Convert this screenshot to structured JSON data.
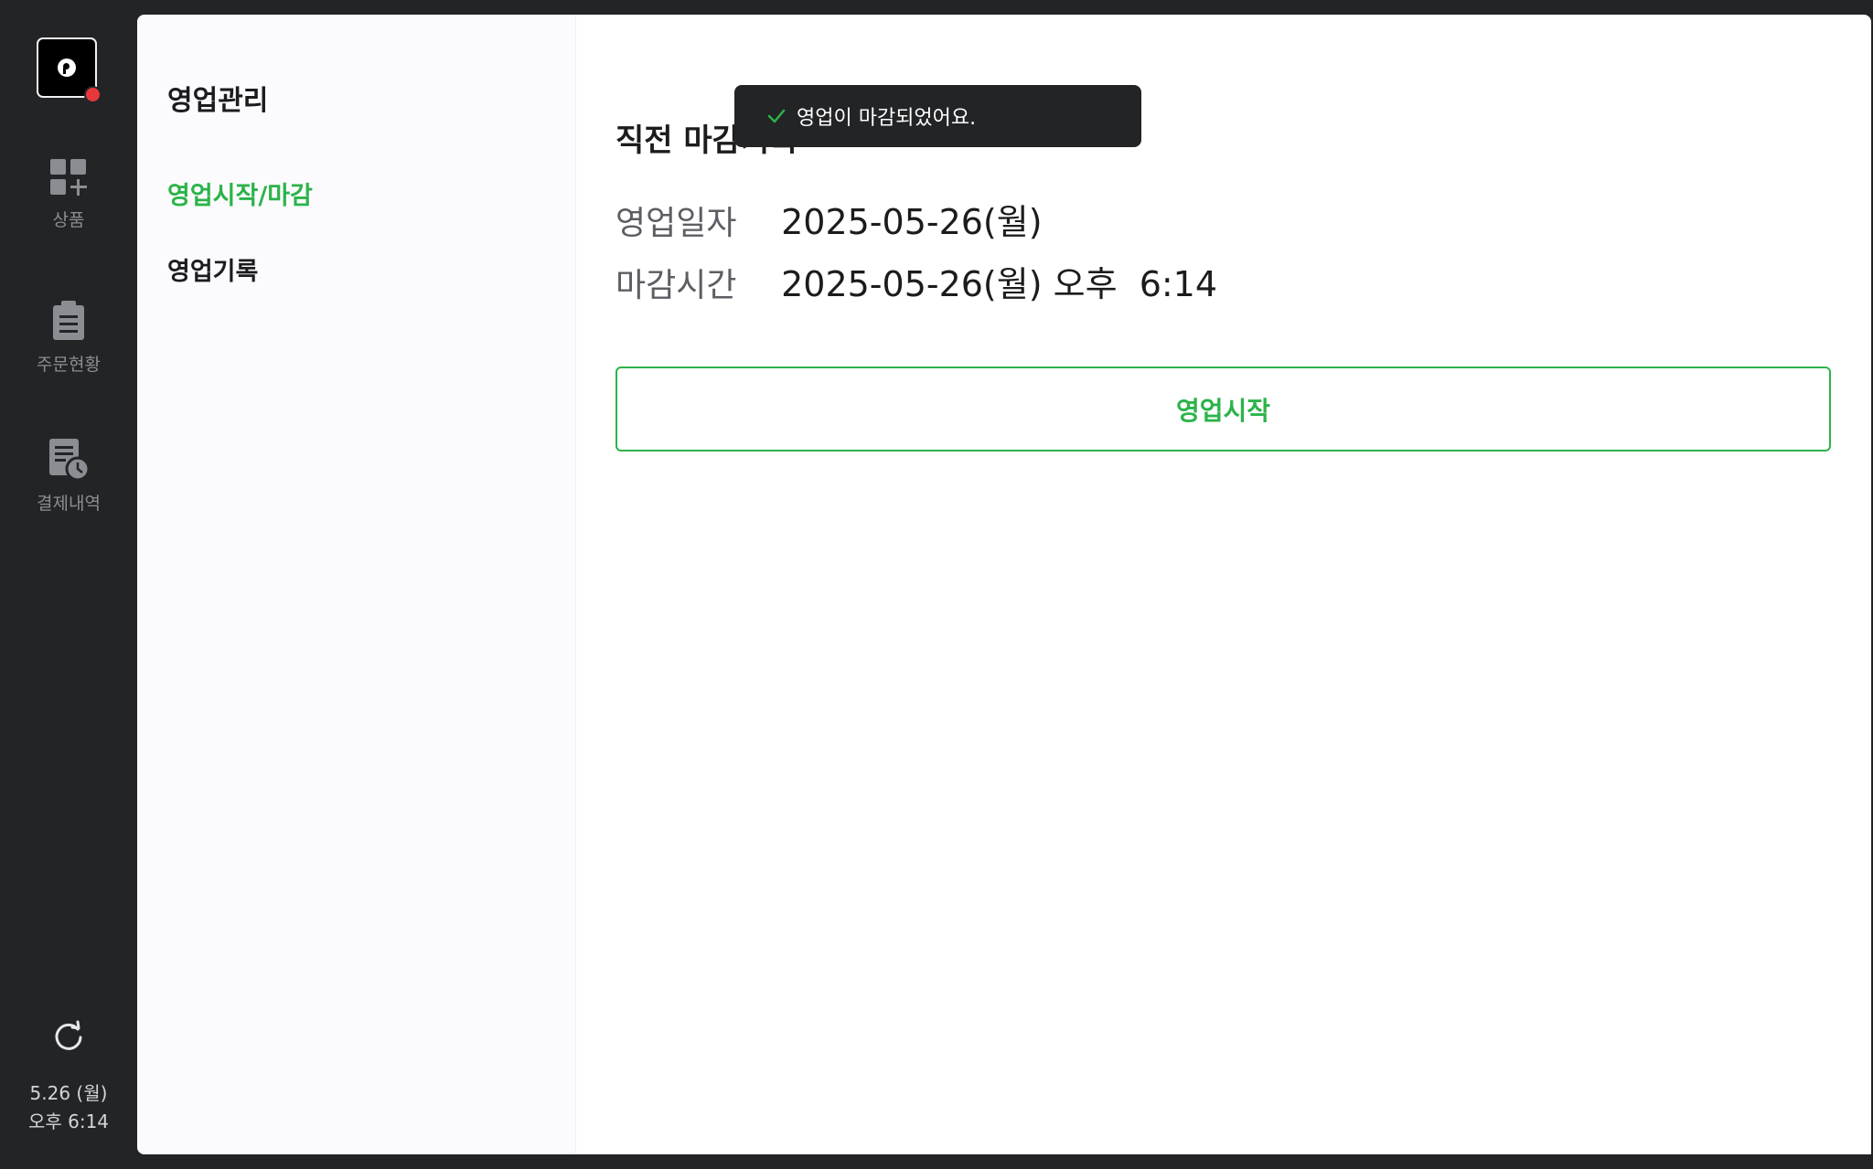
{
  "rail": {
    "items": [
      {
        "label": "상품",
        "icon": "grid-plus-icon"
      },
      {
        "label": "주문현황",
        "icon": "clipboard-icon"
      },
      {
        "label": "결제내역",
        "icon": "receipt-clock-icon"
      }
    ],
    "date": "5.26 (월)",
    "time": "오후 6:14",
    "refresh_icon": "refresh-icon"
  },
  "sub_nav": {
    "title": "영업관리",
    "items": [
      {
        "label": "영업시작/마감",
        "active": true
      },
      {
        "label": "영업기록",
        "active": false
      }
    ]
  },
  "main": {
    "section_title": "직전 마감기록",
    "rows": [
      {
        "label": "영업일자",
        "value": "2025-05-26(월)"
      },
      {
        "label": "마감시간",
        "value": "2025-05-26(월) 오후  6:14"
      }
    ],
    "start_button_label": "영업시작"
  },
  "toast": {
    "message": "영업이 마감되었어요.",
    "icon": "check-icon"
  },
  "colors": {
    "accent": "#2cb34a",
    "rail_bg": "#232426",
    "badge": "#e8383b"
  }
}
